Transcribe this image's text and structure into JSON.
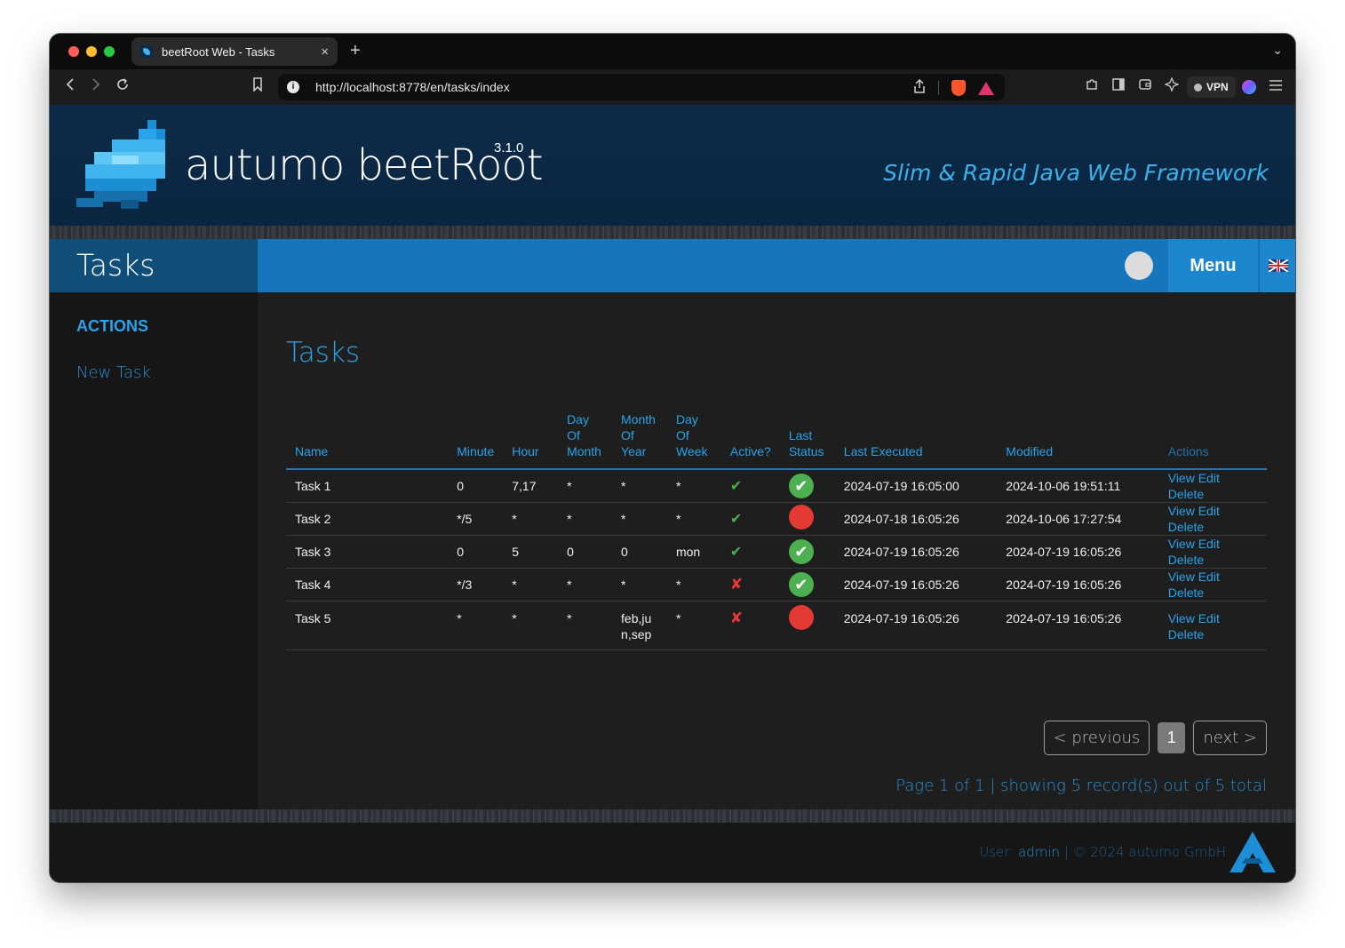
{
  "browser": {
    "tab_title": "beetRoot Web - Tasks",
    "tab_close": "×",
    "new_tab": "+",
    "tab_menu": "⌄",
    "url": "http://localhost:8778/en/tasks/index",
    "vpn_label": "VPN"
  },
  "header": {
    "brand": "autumo beetRoot",
    "version": "3.1.0",
    "tagline": "Slim & Rapid Java Web Framework"
  },
  "titlebar": {
    "page_heading": "Tasks",
    "menu_label": "Menu"
  },
  "sidebar": {
    "heading": "ACTIONS",
    "link_new_task": "New Task"
  },
  "main": {
    "title": "Tasks",
    "columns": [
      "Name",
      "Minute",
      "Hour",
      "Day Of Month",
      "Month Of Year",
      "Day Of Week",
      "Active?",
      "Last Status",
      "Last Executed",
      "Modified",
      "Actions"
    ],
    "column_headers": {
      "name": "Name",
      "minute": "Minute",
      "hour": "Hour",
      "dom_1": "Day",
      "dom_2": "Of",
      "dom_3": "Month",
      "moy_1": "Month",
      "moy_2": "Of",
      "moy_3": "Year",
      "dow_1": "Day",
      "dow_2": "Of",
      "dow_3": "Week",
      "active": "Active?",
      "last_status_1": "Last",
      "last_status_2": "Status",
      "last_executed": "Last Executed",
      "modified": "Modified",
      "actions": "Actions"
    },
    "rows": [
      {
        "name": "Task 1",
        "minute": "0",
        "hour": "7,17",
        "day_of_month": "*",
        "month_of_year": "*",
        "day_of_week": "*",
        "active": "✔",
        "last_status": "✔",
        "last_executed": "2024-07-19 16:05:00",
        "modified": "2024-10-06 19:51:11"
      },
      {
        "name": "Task 2",
        "minute": "*/5",
        "hour": "*",
        "day_of_month": "*",
        "month_of_year": "*",
        "day_of_week": "*",
        "active": "✔",
        "last_status": "",
        "last_executed": "2024-07-18 16:05:26",
        "modified": "2024-10-06 17:27:54"
      },
      {
        "name": "Task 3",
        "minute": "0",
        "hour": "5",
        "day_of_month": "0",
        "month_of_year": "0",
        "day_of_week": "mon",
        "active": "✔",
        "last_status": "✔",
        "last_executed": "2024-07-19 16:05:26",
        "modified": "2024-07-19 16:05:26"
      },
      {
        "name": "Task 4",
        "minute": "*/3",
        "hour": "*",
        "day_of_month": "*",
        "month_of_year": "*",
        "day_of_week": "*",
        "active": "✘",
        "last_status": "✔",
        "last_executed": "2024-07-19 16:05:26",
        "modified": "2024-07-19 16:05:26"
      },
      {
        "name": "Task 5",
        "minute": "*",
        "hour": "*",
        "day_of_month": "*",
        "month_of_year": "feb,ju",
        "month_of_year_2": "n,sep",
        "day_of_week": "*",
        "active": "✘",
        "last_status": "",
        "last_executed": "2024-07-19 16:05:26",
        "modified": "2024-07-19 16:05:26"
      }
    ],
    "row_actions": {
      "view": "View",
      "edit": "Edit",
      "delete": "Delete"
    },
    "pagination": {
      "previous": "< previous",
      "current": "1",
      "next": "next >",
      "info": "Page 1 of 1 | showing 5 record(s) out of 5 total"
    }
  },
  "footer": {
    "user_prefix": "User: ",
    "user_name": "admin",
    "copyright": " | © 2024 autumo GmbH"
  },
  "colors": {
    "accent": "#2aa3ea",
    "header_bg": "#0d2b48",
    "titlebar_blue": "#1676bd",
    "ok_green": "#4caf50",
    "error_red": "#e53935"
  },
  "icons": {
    "back": "chevron-left-icon",
    "forward": "chevron-right-icon",
    "reload": "reload-icon",
    "bookmark": "bookmark-icon",
    "share": "share-icon",
    "shield": "brave-shield-icon",
    "rewards": "brave-rewards-icon",
    "extensions": "extensions-icon",
    "sidebar": "sidebar-icon",
    "wallet": "wallet-icon",
    "leo": "leo-icon",
    "menu": "hamburger-menu-icon"
  }
}
